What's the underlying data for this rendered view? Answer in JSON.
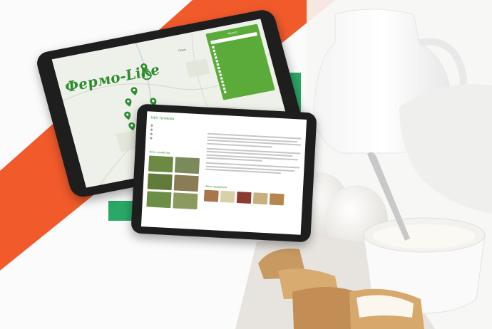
{
  "colors": {
    "accent_orange": "#f15a2b",
    "accent_green": "#2aa866",
    "brand_green": "#2f8d2f",
    "panel_green": "#5bab3a",
    "tablet_frame": "#1e1e1f"
  },
  "map_app": {
    "logo": "Фермо-Like",
    "filter_title": "Фильтр",
    "filter_items": [
      "",
      "",
      "",
      "",
      "",
      "",
      "",
      "",
      "",
      "",
      "",
      "",
      "",
      ""
    ],
    "place_labels": [
      "Пермь"
    ]
  },
  "farm_app": {
    "farm_name": "КФХ Тупикова",
    "about_title": "",
    "gallery_title": "Фото хозяйства",
    "products_title": "Наша продукция",
    "footer_link": "",
    "product_labels": [
      "",
      "",
      "",
      "",
      ""
    ]
  }
}
